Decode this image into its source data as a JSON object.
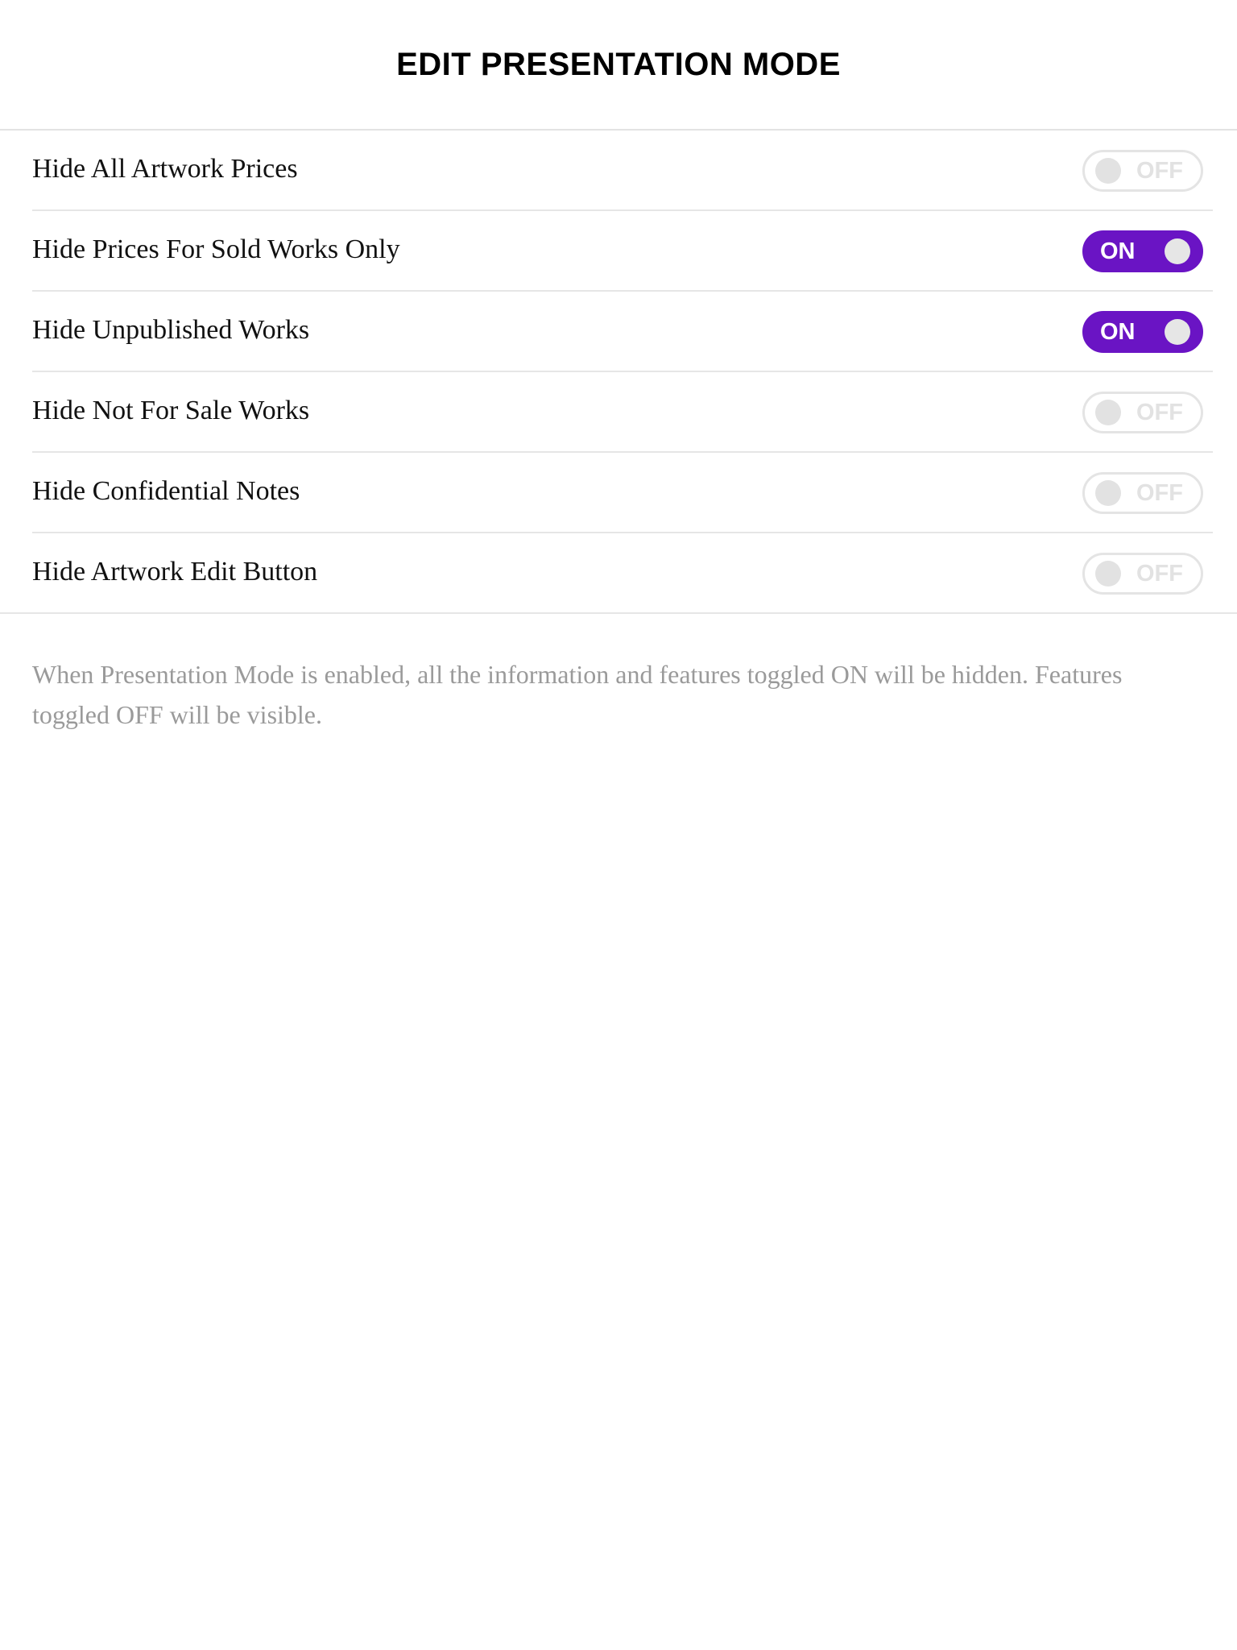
{
  "header": {
    "title": "EDIT PRESENTATION MODE"
  },
  "settings": [
    {
      "label": "Hide All Artwork Prices",
      "state": "OFF",
      "enabled": false
    },
    {
      "label": "Hide Prices For Sold Works Only",
      "state": "ON",
      "enabled": true
    },
    {
      "label": "Hide Unpublished Works",
      "state": "ON",
      "enabled": true
    },
    {
      "label": "Hide Not For Sale Works",
      "state": "OFF",
      "enabled": false
    },
    {
      "label": "Hide Confidential Notes",
      "state": "OFF",
      "enabled": false
    },
    {
      "label": "Hide Artwork Edit Button",
      "state": "OFF",
      "enabled": false
    }
  ],
  "footnote": "When Presentation Mode is enabled, all the information and features toggled ON will be hidden. Features toggled OFF will be visible.",
  "colors": {
    "accent": "#6A14C4",
    "toggle_off_border": "#E4E4E4",
    "footnote_text": "#9A9A9A"
  }
}
